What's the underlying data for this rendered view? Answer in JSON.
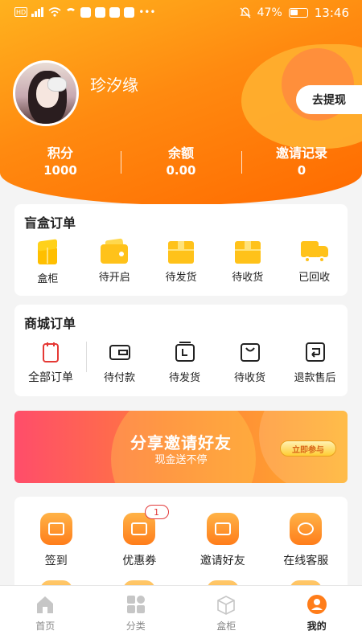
{
  "status_bar": {
    "left_icons": [
      "hd-icon",
      "signal-icon",
      "wifi-icon",
      "call-icon",
      "app-icon-1",
      "app-icon-2",
      "app-icon-3",
      "app-icon-4",
      "more-dots-icon"
    ],
    "battery_percent": "47%",
    "time": "13:46",
    "network_label": "HD"
  },
  "profile": {
    "username": "珍汐缘",
    "withdraw_label": "去提现"
  },
  "stats": [
    {
      "label": "积分",
      "value": "1000"
    },
    {
      "label": "余额",
      "value": "0.00"
    },
    {
      "label": "邀请记录",
      "value": "0"
    }
  ],
  "blind_box_orders": {
    "title": "盲盒订单",
    "items": [
      {
        "label": "盒柜",
        "icon": "cube-icon"
      },
      {
        "label": "待开启",
        "icon": "wallet-icon"
      },
      {
        "label": "待发货",
        "icon": "package-icon"
      },
      {
        "label": "待收货",
        "icon": "package-icon"
      },
      {
        "label": "已回收",
        "icon": "truck-icon"
      }
    ]
  },
  "mall_orders": {
    "title": "商城订单",
    "items": [
      {
        "label": "全部订单",
        "icon": "clipboard-icon"
      },
      {
        "label": "待付款",
        "icon": "wallet-outline-icon"
      },
      {
        "label": "待发货",
        "icon": "box-outline-icon"
      },
      {
        "label": "待收货",
        "icon": "bag-outline-icon"
      },
      {
        "label": "退款售后",
        "icon": "return-icon"
      }
    ]
  },
  "banner": {
    "title": "分享邀请好友",
    "subtitle": "现金送不停",
    "button_label": "立即参与"
  },
  "services": {
    "items": [
      {
        "label": "签到",
        "icon": "checkin-icon"
      },
      {
        "label": "优惠券",
        "icon": "coupon-icon",
        "badge": "1"
      },
      {
        "label": "邀请好友",
        "icon": "gift-icon"
      },
      {
        "label": "在线客服",
        "icon": "customer-service-icon"
      }
    ]
  },
  "tabbar": {
    "items": [
      {
        "label": "首页",
        "icon": "home-icon",
        "active": false
      },
      {
        "label": "分类",
        "icon": "category-icon",
        "active": false
      },
      {
        "label": "盒柜",
        "icon": "box-cabinet-icon",
        "active": false
      },
      {
        "label": "我的",
        "icon": "profile-icon",
        "active": true
      }
    ]
  },
  "colors": {
    "header_start": "#ffb21e",
    "header_end": "#ff6a00",
    "accent_yellow": "#ffc21a",
    "badge_red": "#e23a3a"
  }
}
